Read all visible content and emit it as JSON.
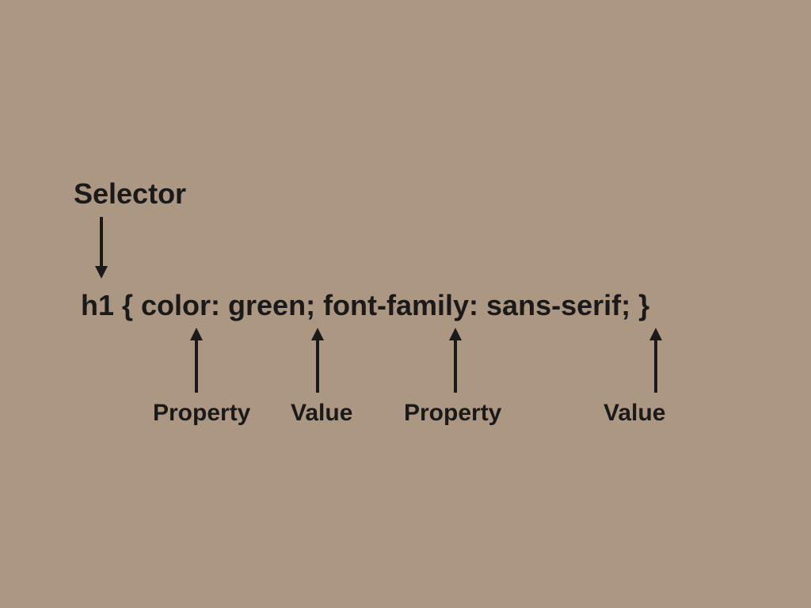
{
  "labels": {
    "selector": "Selector",
    "property1": "Property",
    "value1": "Value",
    "property2": "Property",
    "value2": "Value"
  },
  "code": "h1 { color: green; font-family: sans-serif; }",
  "colors": {
    "background": "#ac9783",
    "text": "#1a1a1a",
    "arrow": "#1a1a1a"
  }
}
